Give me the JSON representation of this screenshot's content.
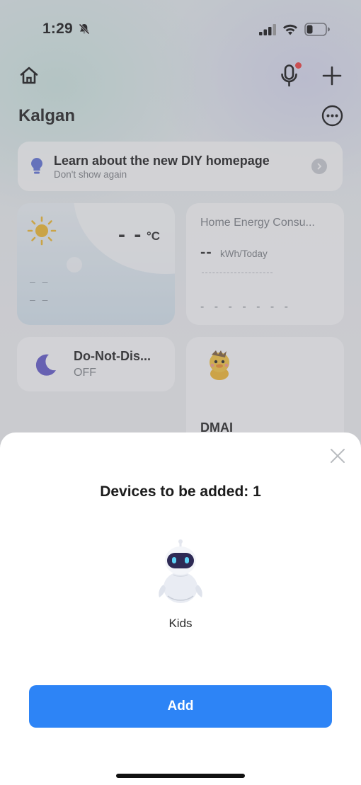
{
  "status_bar": {
    "time": "1:29"
  },
  "header": {
    "home_name": "Kalgan"
  },
  "banner": {
    "title": "Learn about the new DIY homepage",
    "subtitle": "Don't show again"
  },
  "weather": {
    "temperature": "- -",
    "unit": "°C",
    "line1": "– –",
    "line2": "– –"
  },
  "energy": {
    "title": "Home Energy Consu...",
    "value": "--",
    "unit": "kWh/Today",
    "placeholder": "- - - - - - -"
  },
  "dnd": {
    "title": "Do-Not-Dis...",
    "status": "OFF"
  },
  "device_card": {
    "label": "DMAI"
  },
  "sheet": {
    "title": "Devices to be added: 1",
    "device_name": "Kids",
    "add_label": "Add"
  },
  "colors": {
    "accent": "#2d84f6",
    "notify_dot": "#ef3b3b",
    "moon": "#5f56c9",
    "sun": "#f1b92b"
  },
  "icons": [
    "bell-slash-icon",
    "signal-icon",
    "wifi-icon",
    "battery-icon",
    "home-icon",
    "microphone-icon",
    "plus-icon",
    "more-icon",
    "lightbulb-icon",
    "chevron-right-icon",
    "sun-icon",
    "moon-icon",
    "duck-device-icon",
    "close-icon",
    "robot-device-icon"
  ]
}
